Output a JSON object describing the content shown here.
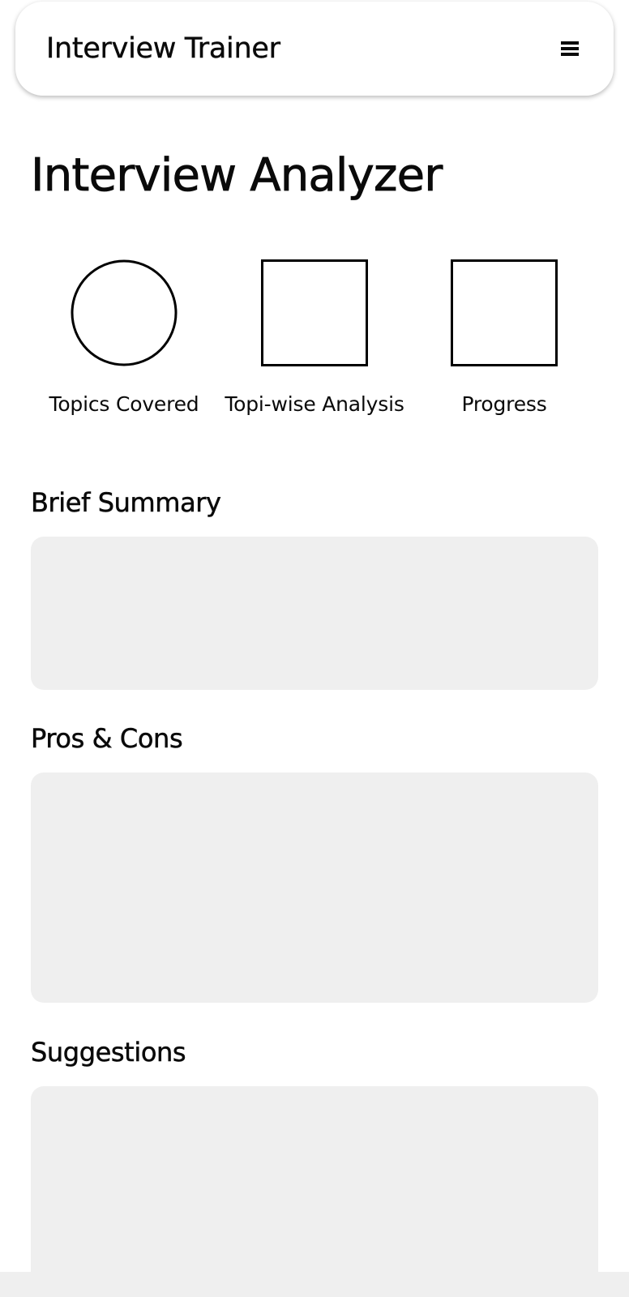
{
  "app_bar": {
    "title": "Interview Trainer",
    "menu_icon": "hamburger-icon"
  },
  "page": {
    "title": "Interview Analyzer"
  },
  "cards": [
    {
      "label": "Topics Covered",
      "shape": "circle"
    },
    {
      "label": "Topi-wise Analysis",
      "shape": "square"
    },
    {
      "label": "Progress",
      "shape": "square"
    }
  ],
  "sections": {
    "brief_summary": {
      "heading": "Brief Summary"
    },
    "pros_cons": {
      "heading": "Pros & Cons"
    },
    "suggestions": {
      "heading": "Suggestions"
    }
  },
  "colors": {
    "background": "#ffffff",
    "panel": "#efefef",
    "text": "#0a0a0a",
    "outline": "#000000"
  }
}
